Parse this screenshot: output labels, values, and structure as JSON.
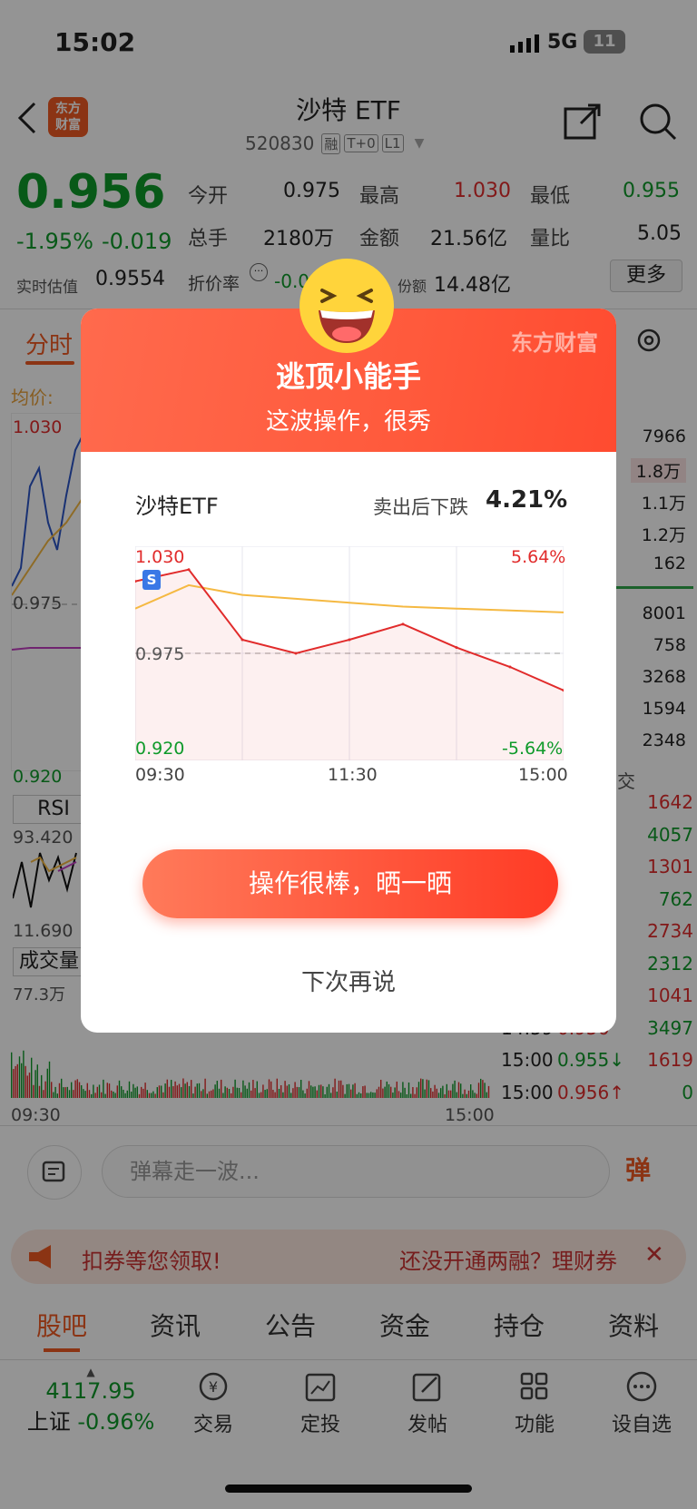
{
  "status_bar": {
    "time": "15:02",
    "network": "5G",
    "battery": "11"
  },
  "header": {
    "title": "沙特 ETF",
    "code": "520830",
    "badges": [
      "融",
      "T+0",
      "L1"
    ],
    "logo_text_1": "东方",
    "logo_text_2": "财富"
  },
  "quote": {
    "price": "0.956",
    "change_pct": "-1.95%",
    "change": "-0.019",
    "fields": [
      {
        "label": "今开",
        "value": "0.975"
      },
      {
        "label": "最高",
        "value": "1.030"
      },
      {
        "label": "最低",
        "value": "0.955"
      },
      {
        "label": "总手",
        "value": "2180万"
      },
      {
        "label": "金额",
        "value": "21.56亿"
      },
      {
        "label": "量比",
        "value": "5.05"
      }
    ],
    "est_label": "实时估值",
    "est_value": "0.9554",
    "premium_label": "折价率",
    "premium_value": "-0.0",
    "share_label": "份额",
    "share_value": "14.48亿",
    "more_label": "更多"
  },
  "chart_tabs": {
    "active": "分时",
    "avg_label": "均价:"
  },
  "main_chart": {
    "top": "1.030",
    "mid": "0.975",
    "bottom": "0.920",
    "rsi_label": "RSI",
    "rsi_top": "93.420",
    "rsi_bottom": "11.690",
    "vol_label": "成交量",
    "vol_top": "77.3万",
    "time_start": "09:30",
    "time_end": "15:00"
  },
  "order_book": [
    "7966",
    "1.8万",
    "1.1万",
    "1.2万",
    "162",
    "8001",
    "758",
    "3268",
    "1594",
    "2348"
  ],
  "ticks": {
    "header": "交",
    "rows": [
      {
        "time": "",
        "price": "",
        "vol": "1642"
      },
      {
        "time": "",
        "price": "",
        "vol": "4057"
      },
      {
        "time": "",
        "price": "",
        "vol": "1301"
      },
      {
        "time": "",
        "price": "",
        "vol": "762"
      },
      {
        "time": "",
        "price": "",
        "vol": "2734"
      },
      {
        "time": "",
        "price": "",
        "vol": "2312"
      },
      {
        "time": "",
        "price": "",
        "vol": "1041"
      },
      {
        "time": "14:59",
        "price": "0.956",
        "vol": "3497"
      },
      {
        "time": "15:00",
        "price": "0.955↓",
        "vol": "1619"
      },
      {
        "time": "15:00",
        "price": "0.956↑",
        "vol": "0"
      }
    ]
  },
  "danmu": {
    "placeholder": "弹幕走一波...",
    "button": "弹"
  },
  "banner": {
    "left": "扣券等您领取!",
    "right": "还没开通两融？理财券"
  },
  "bottom_tabs": [
    "股吧",
    "资讯",
    "公告",
    "资金",
    "持仓",
    "资料"
  ],
  "dock": {
    "index_value": "4117.95",
    "index_name": "上证",
    "index_change": "-0.96%",
    "items": [
      "交易",
      "定投",
      "发帖",
      "功能",
      "设自选"
    ]
  },
  "modal": {
    "brand": "东方财富",
    "title": "逃顶小能手",
    "subtitle": "这波操作，很秀",
    "stock": "沙特ETF",
    "drop_label": "卖出后下跌",
    "drop_value": "4.21%",
    "chart": {
      "top_left": "1.030",
      "top_right": "5.64%",
      "mid": "0.975",
      "bottom_left": "0.920",
      "bottom_right": "-5.64%",
      "t1": "09:30",
      "t2": "11:30",
      "t3": "15:00",
      "marker": "S"
    },
    "primary_button": "操作很棒，晒一晒",
    "secondary_button": "下次再说"
  },
  "chart_data": {
    "type": "line",
    "title": "",
    "x": [
      "09:30",
      "10:00",
      "10:30",
      "11:00",
      "11:30",
      "13:30",
      "14:00",
      "14:30",
      "15:00"
    ],
    "series": [
      {
        "name": "",
        "values": [
          1.012,
          1.018,
          0.982,
          0.975,
          0.982,
          0.99,
          0.978,
          0.968,
          0.956
        ]
      },
      {
        "name": "",
        "values": [
          0.998,
          1.01,
          1.005,
          1.003,
          1.001,
          0.999,
          0.998,
          0.997,
          0.996
        ]
      }
    ],
    "ylim": [
      0.92,
      1.03
    ],
    "grid": true,
    "colors": {
      "price": "#e12b2b",
      "avg": "#f5b942"
    }
  }
}
